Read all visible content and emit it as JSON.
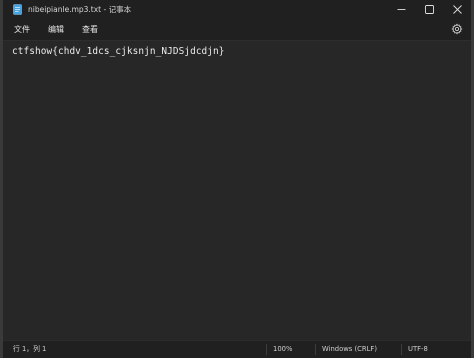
{
  "window": {
    "title": "nibeipianle.mp3.txt - 记事本",
    "buttons": {
      "minimize_icon": "minimize-icon",
      "maximize_icon": "maximize-icon",
      "close_icon": "close-icon"
    }
  },
  "menu": {
    "items": [
      {
        "label": "文件"
      },
      {
        "label": "编辑"
      },
      {
        "label": "查看"
      }
    ],
    "settings_icon": "gear-icon"
  },
  "editor": {
    "content": "ctfshow{chdv_1dcs_cjksnjn_NJDSjdcdjn}"
  },
  "status": {
    "position": "行 1，列 1",
    "zoom": "100%",
    "line_ending": "Windows (CRLF)",
    "encoding": "UTF-8"
  },
  "colors": {
    "background": "#272727",
    "chrome": "#202020",
    "text": "#ececec"
  }
}
